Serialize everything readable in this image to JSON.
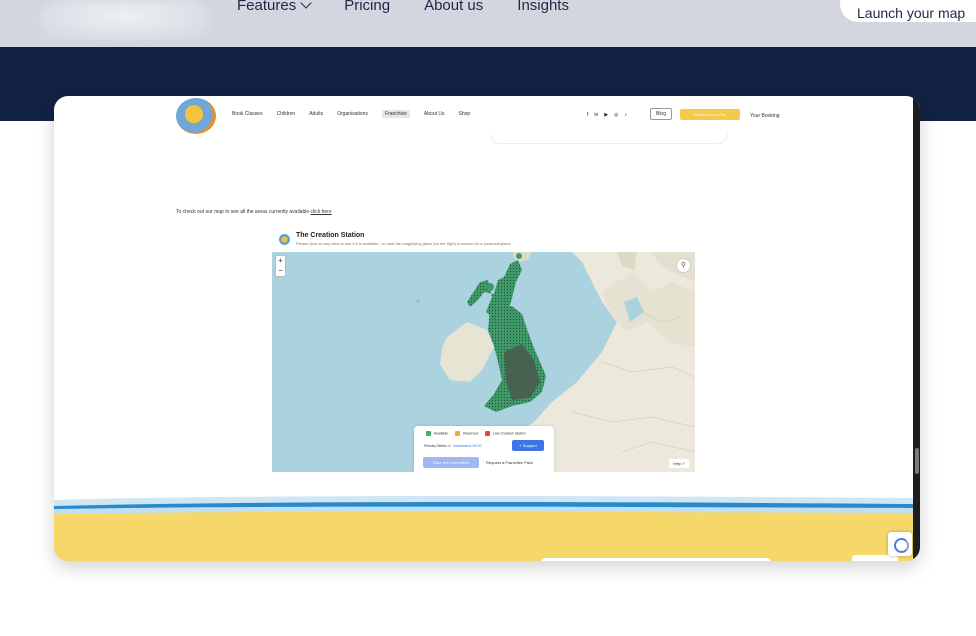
{
  "nav": {
    "items": [
      {
        "label": "Features",
        "has_dropdown": true
      },
      {
        "label": "Pricing"
      },
      {
        "label": "About us"
      },
      {
        "label": "Insights"
      }
    ],
    "launch_label": "Launch your map"
  },
  "screenshot": {
    "inner_nav": [
      "Book Classes",
      "Children",
      "Adults",
      "Organisations",
      "Franchise",
      "About Us",
      "Shop"
    ],
    "inner_nav_active": "Franchise",
    "socials": [
      "f",
      "in",
      "▶",
      "◎",
      "♪"
    ],
    "blog_label": "Blog",
    "cta_label": "Activities Near Me",
    "booking_label": "Your Booking",
    "map_intro": "To check out our map to see all the areas currently available",
    "map_intro_link": "click here",
    "station_title": "The Creation Station",
    "station_sub": "Please click on any area to see if it is available - or click the magnifying glass (on the right) to search for a postcode/place",
    "zoom_in": "+",
    "zoom_out": "−",
    "legend": {
      "available": "Available",
      "reserved": "Reserved",
      "live": "Live Creation Station",
      "info_prefix": "Primary Metric: 0 ·",
      "info_value": "Investment: £0.00",
      "support_label": "+ Support",
      "save_label": "Save the information",
      "pack_label": "Request a Franchise Pack",
      "colors": {
        "available": "#3cb371",
        "reserved": "#f0a830",
        "live": "#e04a3a"
      }
    },
    "help_label": "Help ?"
  },
  "colors": {
    "navy": "#132244",
    "nav_bg": "#d3d6de",
    "yellow": "#f6d76a"
  }
}
